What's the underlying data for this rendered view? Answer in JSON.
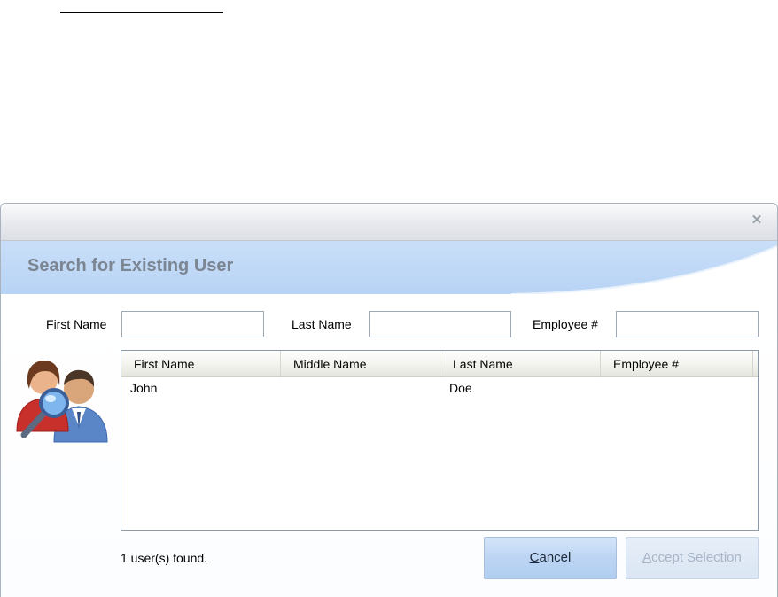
{
  "dialog": {
    "heading": "Search for Existing User",
    "close_icon": "close-icon"
  },
  "search": {
    "first_name": {
      "label": "First Name",
      "mnemonic": "F",
      "value": ""
    },
    "last_name": {
      "label": "Last Name",
      "mnemonic": "L",
      "value": ""
    },
    "employee": {
      "label": "Employee #",
      "mnemonic": "E",
      "value": ""
    }
  },
  "illustration": {
    "icon": "users-search-icon"
  },
  "grid": {
    "columns": [
      "First Name",
      "Middle Name",
      "Last Name",
      "Employee #"
    ],
    "rows": [
      {
        "first_name": "John",
        "middle_name": "",
        "last_name": "Doe",
        "employee": ""
      }
    ]
  },
  "status": {
    "text": "1 user(s) found."
  },
  "buttons": {
    "cancel": {
      "label": "Cancel",
      "mnemonic": "C"
    },
    "accept": {
      "label": "Accept Selection",
      "mnemonic": "A",
      "enabled": false
    }
  },
  "colors": {
    "banner": "#c1d9f6",
    "heading": "#7c8592",
    "cancel_button": "#bdd5f3",
    "accept_disabled_text": "#a6b4c6"
  }
}
